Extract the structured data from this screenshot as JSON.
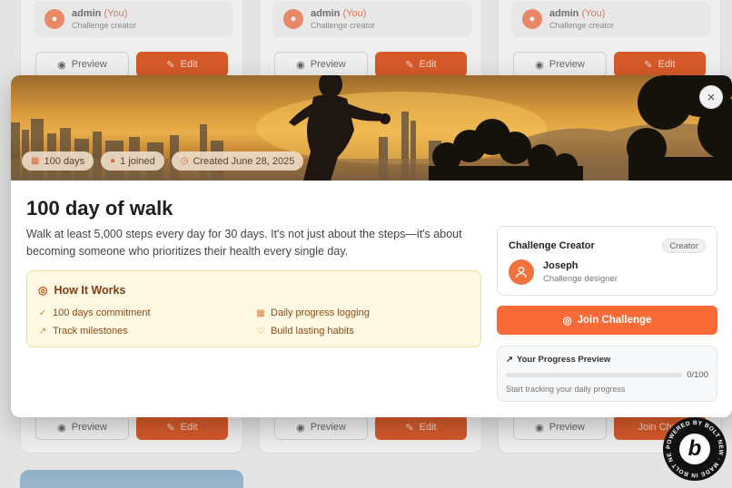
{
  "background_cards": [
    {
      "creator_name": "admin",
      "you_label": "(You)",
      "creator_role": "Challenge creator",
      "preview_label": "Preview",
      "edit_label": "Edit"
    },
    {
      "creator_name": "admin",
      "you_label": "(You)",
      "creator_role": "Challenge creator",
      "preview_label": "Preview",
      "edit_label": "Edit"
    },
    {
      "creator_name": "admin",
      "you_label": "(You)",
      "creator_role": "Challenge creator",
      "preview_label": "Preview",
      "edit_label": "Edit"
    }
  ],
  "background_bottom_buttons": [
    {
      "preview_label": "Preview",
      "edit_label": "Edit"
    },
    {
      "preview_label": "Preview",
      "edit_label": "Edit"
    },
    {
      "preview_label": "Preview",
      "edit_label": "Join Chall"
    }
  ],
  "modal": {
    "close_icon": "×",
    "chips": [
      {
        "icon": "calendar-icon",
        "label": "100 days"
      },
      {
        "icon": "users-icon",
        "label": "1 joined"
      },
      {
        "icon": "clock-icon",
        "label": "Created June 28, 2025"
      }
    ],
    "title": "100 day of walk",
    "description": "Walk at least 5,000 steps every day for 30 days. It's not just about the steps—it's about becoming someone who prioritizes their health every single day.",
    "how_it_works": {
      "title": "How It Works",
      "items": [
        {
          "icon": "check-circle-icon",
          "label": "100 days commitment"
        },
        {
          "icon": "calendar-icon",
          "label": "Daily progress logging"
        },
        {
          "icon": "trending-up-icon",
          "label": "Track milestones"
        },
        {
          "icon": "heart-icon",
          "label": "Build lasting habits"
        }
      ]
    },
    "creator": {
      "title": "Challenge Creator",
      "badge": "Creator",
      "name": "Joseph",
      "role": "Challenge designer"
    },
    "join_button": "Join Challenge",
    "progress": {
      "title": "Your Progress Preview",
      "count": "0/100",
      "fraction": 0,
      "hint": "Start tracking your daily progress"
    }
  },
  "colors": {
    "accent": "#f96a36",
    "how_bg": "#fff8e3",
    "how_text": "#7a3e12"
  },
  "bolt_badge": {
    "ring_text": "POWERED BY BOLT NEW · MADE IN BOLT NEW ·",
    "letter": "b"
  }
}
